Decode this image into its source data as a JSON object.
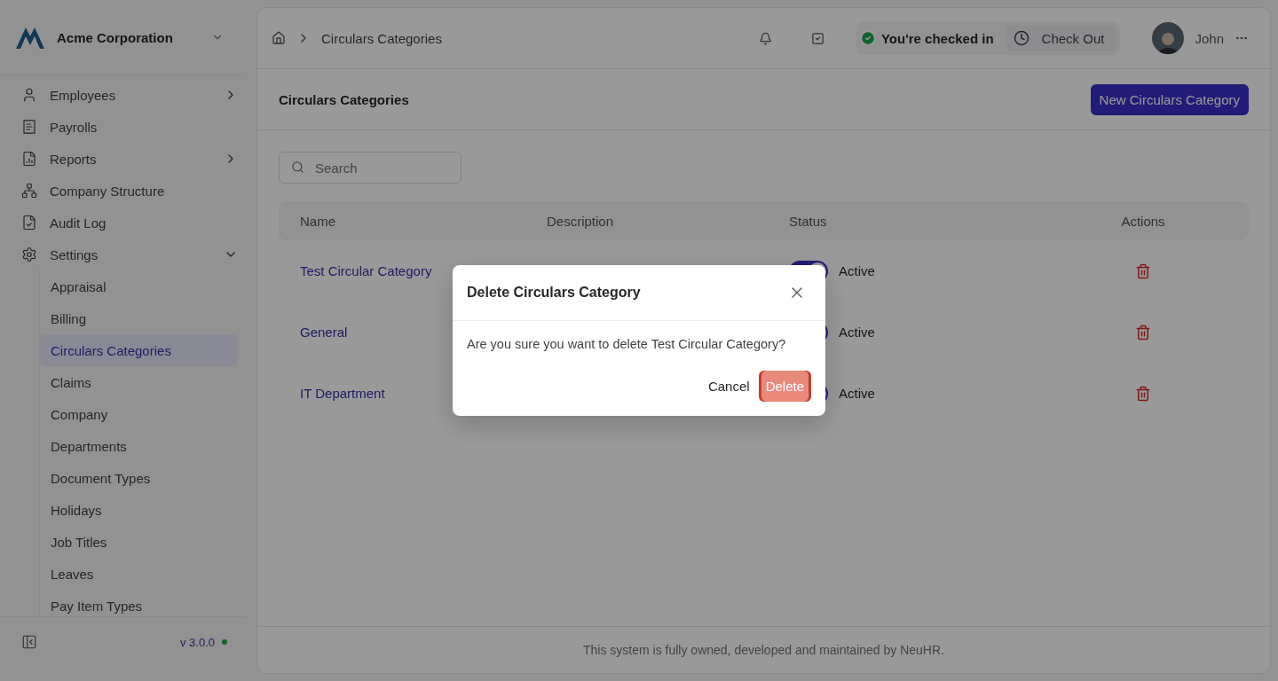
{
  "company": {
    "name": "Acme Corporation"
  },
  "sidebar": {
    "items": [
      {
        "label": "Employees",
        "expanded": false
      },
      {
        "label": "Payrolls"
      },
      {
        "label": "Reports",
        "expanded": false
      },
      {
        "label": "Company Structure"
      },
      {
        "label": "Audit Log"
      },
      {
        "label": "Settings",
        "expanded": true,
        "children": [
          {
            "label": "Appraisal",
            "selected": false
          },
          {
            "label": "Billing",
            "selected": false
          },
          {
            "label": "Circulars Categories",
            "selected": true
          },
          {
            "label": "Claims",
            "selected": false
          },
          {
            "label": "Company",
            "selected": false
          },
          {
            "label": "Departments",
            "selected": false
          },
          {
            "label": "Document Types",
            "selected": false
          },
          {
            "label": "Holidays",
            "selected": false
          },
          {
            "label": "Job Titles",
            "selected": false
          },
          {
            "label": "Leaves",
            "selected": false
          },
          {
            "label": "Pay Item Types",
            "selected": false
          }
        ]
      }
    ],
    "version": "v 3.0.0",
    "online": true
  },
  "topbar": {
    "breadcrumb": "Circulars Categories",
    "checkin_status": "You're checked in",
    "checkout_label": "Check Out",
    "user_name": "John"
  },
  "page": {
    "title": "Circulars Categories",
    "new_button": "New Circulars Category",
    "search": {
      "placeholder": "Search"
    }
  },
  "table": {
    "columns": [
      "Name",
      "Description",
      "Status",
      "Actions"
    ],
    "rows": [
      {
        "name": "Test Circular Category",
        "status": "Active",
        "on": true
      },
      {
        "name": "General",
        "status": "Active",
        "on": true
      },
      {
        "name": "IT Department",
        "status": "Active",
        "on": true
      }
    ]
  },
  "footer": "This system is fully owned, developed and maintained by NeuHR.",
  "dialog": {
    "title": "Delete Circulars Category",
    "message": "Are you sure you want to delete Test Circular Category?",
    "cancel": "Cancel",
    "confirm": "Delete"
  }
}
